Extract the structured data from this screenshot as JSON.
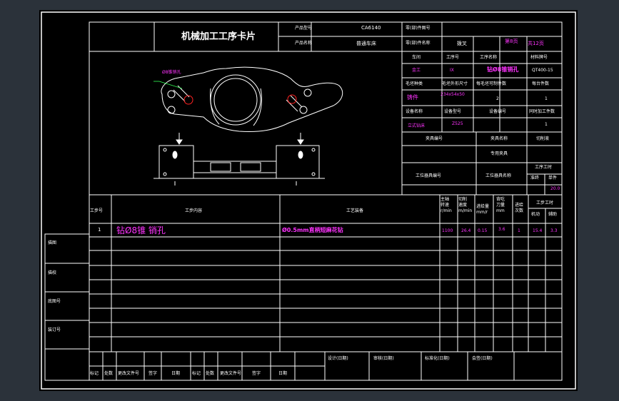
{
  "card": {
    "title": "机械加工工序卡片",
    "product_model_label": "产品型号",
    "product_model_value": "CA6140",
    "product_name_label": "产品名称",
    "product_name_value": "普通车床",
    "part_no_label": "零(部)件图号",
    "part_name_label": "零(部)件名称",
    "part_name_value": "拨叉",
    "sheet_total": "共12页",
    "sheet_no": "第8页"
  },
  "info": {
    "workshop_label": "车间",
    "op_no_label": "工序号",
    "op_name_label": "工序名称",
    "material_label": "材料牌号",
    "workshop_value": "金工",
    "op_no_value": "IX",
    "op_name_value": "钻Ø8锥销孔",
    "material_value": "QT400-15",
    "blank_type_label": "毛坯种类",
    "blank_size_label": "毛坯外形尺寸",
    "blanks_per_label": "每毛坯可制件数",
    "parts_per_label": "每台件数",
    "blank_type_value": "铸件",
    "blank_size_value": "234x54x50",
    "blanks_per_value": "2",
    "parts_per_value": "1",
    "equip_name_label": "设备名称",
    "equip_model_label": "设备型号",
    "equip_no_label": "设备编号",
    "simul_label": "同时加工件数",
    "equip_name_value": "立式钻床",
    "equip_model_value": "Z525",
    "simul_value": "1",
    "fixture_no_label": "夹具编号",
    "fixture_name_label": "夹具名称",
    "coolant_label": "切削液",
    "fixture_name_value": "专用夹具",
    "station_no_label": "工位器具编号",
    "station_name_label": "工位器具名称",
    "time_label": "工序工时",
    "prep_label": "准终",
    "unit_label": "单件",
    "unit_value": "20.0"
  },
  "drawing": {
    "callout": "Ø8锥销孔"
  },
  "steps": {
    "no_label": "工步号",
    "content_label": "工步内容",
    "equip_label": "工艺装备",
    "spindle_label": "主轴\n转速\nr/min",
    "cutspeed_label": "切削\n速度\nm/min",
    "feed_label": "进给量\nmm/r",
    "depth_label": "背吃\n刀量\nmm",
    "passes_label": "进给\n次数",
    "time_label": "工步工时",
    "machine_label": "机动",
    "aux_label": "辅助",
    "rows": [
      {
        "no": "1",
        "content": "钻Ø8锥 销孔",
        "equip": "Ø0.5mm直柄短麻花钻",
        "spindle": "1100",
        "cutspeed": "26.4",
        "feed": "0.15",
        "depth": "3.6",
        "passes": "1",
        "machine": "15.4",
        "aux": "3.3"
      }
    ]
  },
  "side": [
    "描图",
    "描校",
    "底图号",
    "装订号"
  ],
  "bottom": {
    "design": "设计(日期)",
    "review": "审核(日期)",
    "standard": "标准化(日期)",
    "sign": "会签(日期)",
    "cols": [
      "标记",
      "处数",
      "更改文件号",
      "签字",
      "日期",
      "标记",
      "处数",
      "更改文件号",
      "签字",
      "日期"
    ]
  },
  "colors": {
    "background": "#000000",
    "outer": "#2b323a",
    "line": "#ffffff",
    "accent": "#ff33ff",
    "leader": "#33ff55",
    "hole": "#ff2222"
  }
}
